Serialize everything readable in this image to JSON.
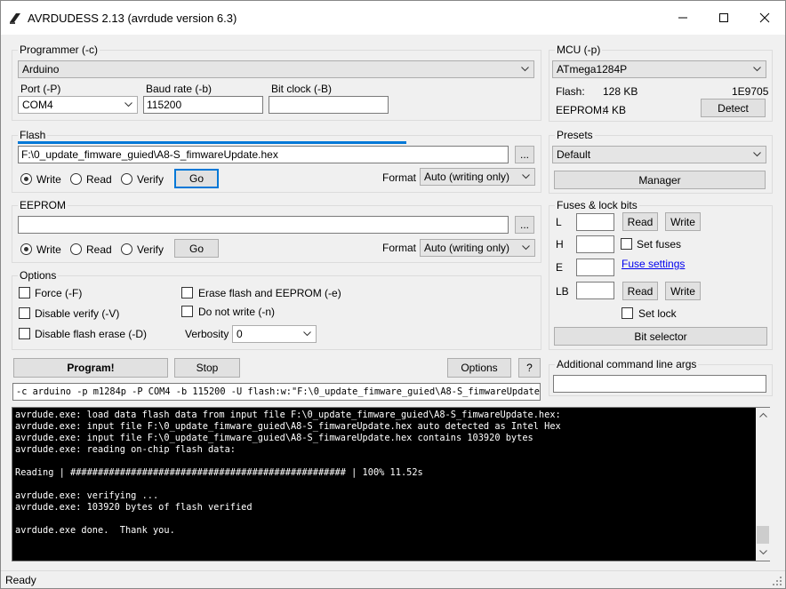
{
  "window": {
    "title": "AVRDUDESS 2.13 (avrdude version 6.3)",
    "minimize_glyph": "—",
    "maximize_glyph": "☐",
    "close_glyph": "✕"
  },
  "programmer": {
    "group_label": "Programmer (-c)",
    "selected": "Arduino",
    "port_label": "Port (-P)",
    "port_value": "COM4",
    "baud_label": "Baud rate (-b)",
    "baud_value": "115200",
    "bitclock_label": "Bit clock (-B)",
    "bitclock_value": ""
  },
  "flash": {
    "group_label": "Flash",
    "file": "F:\\0_update_fimware_guied\\A8-S_fimwareUpdate.hex",
    "progress_fraction": 0.98,
    "browse_label": "...",
    "write_label": "Write",
    "read_label": "Read",
    "verify_label": "Verify",
    "go_label": "Go",
    "format_label": "Format",
    "format_value": "Auto (writing only)"
  },
  "eeprom": {
    "group_label": "EEPROM",
    "file": "",
    "browse_label": "...",
    "write_label": "Write",
    "read_label": "Read",
    "verify_label": "Verify",
    "go_label": "Go",
    "format_label": "Format",
    "format_value": "Auto (writing only)"
  },
  "options": {
    "group_label": "Options",
    "force": "Force (-F)",
    "disable_verify": "Disable verify (-V)",
    "disable_flash_erase": "Disable flash erase (-D)",
    "erase_flash_eeprom": "Erase flash and EEPROM (-e)",
    "do_not_write": "Do not write (-n)",
    "verbosity_label": "Verbosity",
    "verbosity_value": "0"
  },
  "actions": {
    "program": "Program!",
    "stop": "Stop",
    "options": "Options",
    "help": "?"
  },
  "command_line": "-c arduino -p m1284p -P COM4 -b 115200 -U flash:w:\"F:\\0_update_fimware_guied\\A8-S_fimwareUpdate.",
  "mcu": {
    "group_label": "MCU (-p)",
    "selected": "ATmega1284P",
    "flash_label": "Flash:",
    "flash_value": "128 KB",
    "signature": "1E9705",
    "eeprom_label": "EEPROM:",
    "eeprom_value": "4 KB",
    "detect": "Detect"
  },
  "presets": {
    "group_label": "Presets",
    "selected": "Default",
    "manager": "Manager"
  },
  "fuses": {
    "group_label": "Fuses & lock bits",
    "l_label": "L",
    "h_label": "H",
    "e_label": "E",
    "lb_label": "LB",
    "read": "Read",
    "write": "Write",
    "set_fuses": "Set fuses",
    "fuse_settings": "Fuse settings",
    "set_lock": "Set lock",
    "bit_selector": "Bit selector"
  },
  "extra_args": {
    "label": "Additional command line args",
    "value": ""
  },
  "console_lines": [
    "avrdude.exe: load data flash data from input file F:\\0_update_fimware_guied\\A8-S_fimwareUpdate.hex:",
    "avrdude.exe: input file F:\\0_update_fimware_guied\\A8-S_fimwareUpdate.hex auto detected as Intel Hex",
    "avrdude.exe: input file F:\\0_update_fimware_guied\\A8-S_fimwareUpdate.hex contains 103920 bytes",
    "avrdude.exe: reading on-chip flash data:",
    "",
    "Reading | ################################################## | 100% 11.52s",
    "",
    "avrdude.exe: verifying ...",
    "avrdude.exe: 103920 bytes of flash verified",
    "",
    "avrdude.exe done.  Thank you."
  ],
  "status": "Ready",
  "colors": {
    "accent": "#0078d7",
    "console_bg": "#000000",
    "link": "#0000ee"
  }
}
